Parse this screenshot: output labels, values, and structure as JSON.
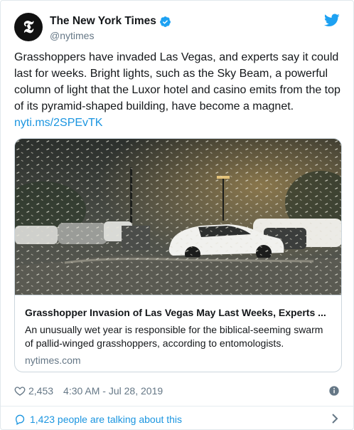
{
  "account": {
    "display_name": "The New York Times",
    "handle": "@nytimes",
    "avatar_letter": "𝕿",
    "verified": true
  },
  "tweet": {
    "text": "Grasshoppers have invaded Las Vegas, and experts say it could last for weeks. Bright lights, such as the Sky Beam, a powerful column of light that the Luxor hotel and casino emits from the top of its pyramid-shaped building, have become a magnet.",
    "link": "nyti.ms/2SPEvTK"
  },
  "link_card": {
    "title": "Grasshopper Invasion of Las Vegas May Last Weeks, Experts ...",
    "description": "An unusually wet year is responsible for the biblical-seeming swarm of pallid-winged grasshoppers, according to entomologists.",
    "domain": "nytimes.com",
    "image": "night-parking-lot-grasshopper-swarm"
  },
  "stats": {
    "likes": "2,453",
    "timestamp": "4:30 AM - Jul 28, 2019"
  },
  "conversation": {
    "text": "1,423 people are talking about this"
  },
  "colors": {
    "link": "#1b95e0",
    "text": "#14171a",
    "muted": "#657786",
    "border": "#ccd6dd"
  }
}
